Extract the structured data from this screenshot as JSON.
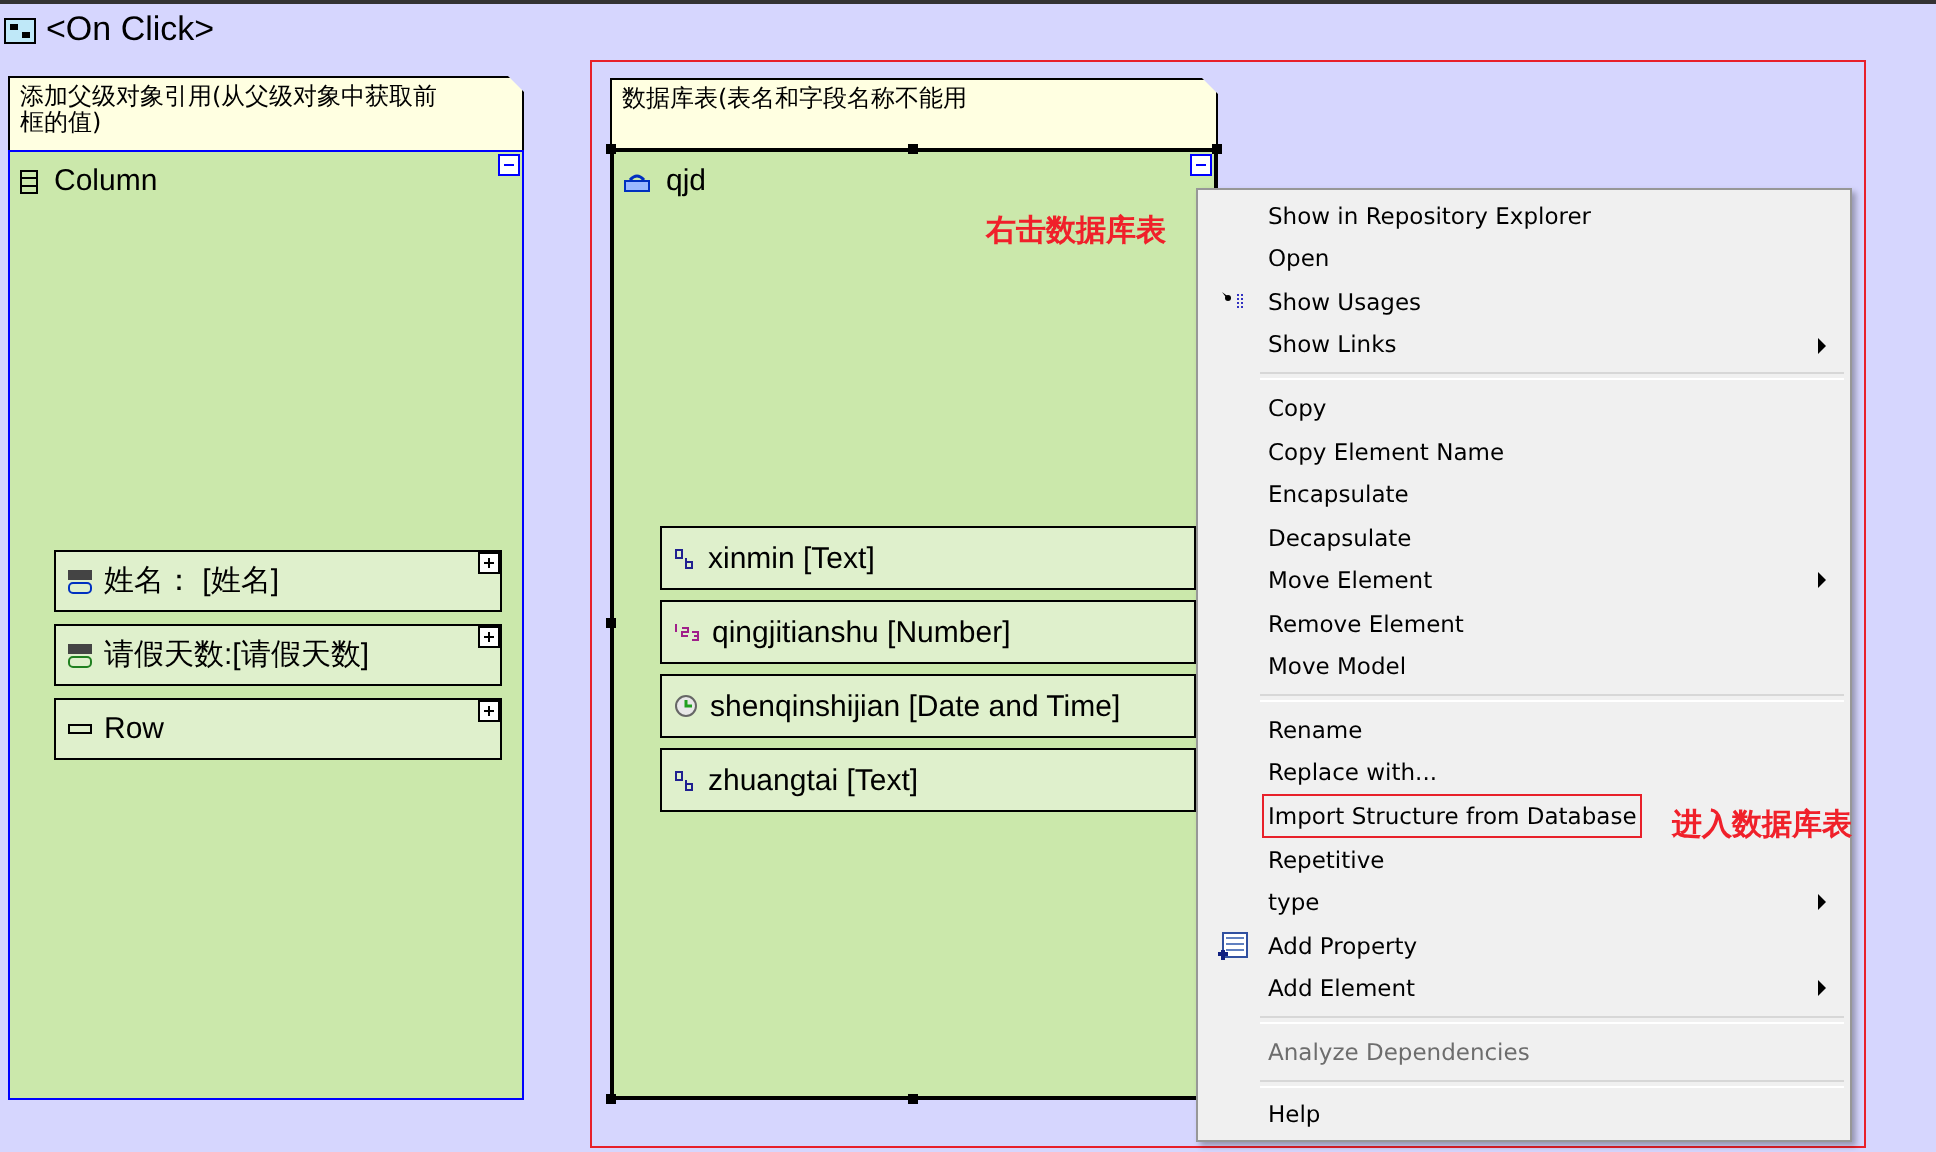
{
  "title": "<On Click>",
  "nodes": [
    {
      "note_lines": [
        "添加父级对象引用(从父级对象中获取前",
        "框的值)"
      ],
      "name": "Column",
      "kind": "column",
      "expanded": true,
      "selected": false,
      "children": [
        {
          "label": "姓名：  [姓名]",
          "kind": "label-text",
          "expanded": false
        },
        {
          "label": "请假天数:[请假天数]",
          "kind": "label-number",
          "expanded": false
        },
        {
          "label": "Row",
          "kind": "row",
          "expanded": false
        }
      ]
    },
    {
      "note_lines": [
        "数据库表(表名和字段名称不能用"
      ],
      "name": "qjd",
      "kind": "table",
      "expanded": true,
      "selected": true,
      "children": [
        {
          "label": "xinmin [Text]",
          "kind": "text"
        },
        {
          "label": "qingjitianshu [Number]",
          "kind": "number"
        },
        {
          "label": "shenqinshijian [Date and Time]",
          "kind": "datetime"
        },
        {
          "label": "zhuangtai [Text]",
          "kind": "text"
        }
      ]
    }
  ],
  "annotations": [
    "右击数据库表",
    "进入数据库表"
  ],
  "menu": [
    {
      "kind": "item",
      "label": "Show in Repository Explorer"
    },
    {
      "kind": "item",
      "label": "Open"
    },
    {
      "kind": "item",
      "label": "Show Usages"
    },
    {
      "kind": "item",
      "label": "Show Links",
      "submenu": true
    },
    {
      "kind": "separator"
    },
    {
      "kind": "item",
      "label": "Copy"
    },
    {
      "kind": "item",
      "label": "Copy Element Name"
    },
    {
      "kind": "item",
      "label": "Encapsulate"
    },
    {
      "kind": "item",
      "label": "Decapsulate"
    },
    {
      "kind": "item",
      "label": "Move Element",
      "submenu": true
    },
    {
      "kind": "item",
      "label": "Remove Element"
    },
    {
      "kind": "item",
      "label": "Move Model"
    },
    {
      "kind": "separator"
    },
    {
      "kind": "item",
      "label": "Rename"
    },
    {
      "kind": "item",
      "label": "Replace with..."
    },
    {
      "kind": "item",
      "label": "Import Structure from Database",
      "boxed": true
    },
    {
      "kind": "item",
      "label": "Repetitive"
    },
    {
      "kind": "item",
      "label": "type",
      "submenu": true
    },
    {
      "kind": "item",
      "label": "Add Property"
    },
    {
      "kind": "item",
      "label": "Add Element",
      "submenu": true
    },
    {
      "kind": "separator"
    },
    {
      "kind": "item",
      "label": "Analyze Dependencies",
      "disabled": true
    },
    {
      "kind": "separator"
    },
    {
      "kind": "item",
      "label": "Help"
    }
  ]
}
